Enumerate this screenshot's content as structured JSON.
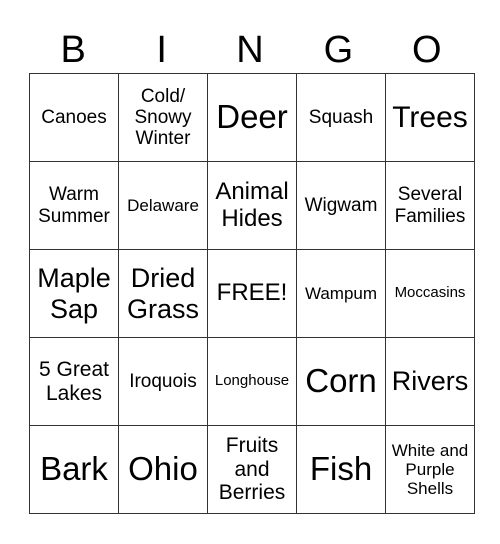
{
  "header": [
    "B",
    "I",
    "N",
    "G",
    "O"
  ],
  "rows": [
    [
      {
        "text": "Canoes",
        "size": "s19"
      },
      {
        "text": "Cold/ Snowy Winter",
        "size": "s19"
      },
      {
        "text": "Deer",
        "size": "s32"
      },
      {
        "text": "Squash",
        "size": "s19"
      },
      {
        "text": "Trees",
        "size": "s30"
      }
    ],
    [
      {
        "text": "Warm Summer",
        "size": "s19"
      },
      {
        "text": "Delaware",
        "size": "s16"
      },
      {
        "text": "Animal Hides",
        "size": "s24"
      },
      {
        "text": "Wigwam",
        "size": "s19"
      },
      {
        "text": "Several Families",
        "size": "s19"
      }
    ],
    [
      {
        "text": "Maple Sap",
        "size": "s27"
      },
      {
        "text": "Dried Grass",
        "size": "s27"
      },
      {
        "text": "FREE!",
        "size": "s24"
      },
      {
        "text": "Wampum",
        "size": "s16"
      },
      {
        "text": "Moccasins",
        "size": "s14"
      }
    ],
    [
      {
        "text": "5 Great Lakes",
        "size": "s21"
      },
      {
        "text": "Iroquois",
        "size": "s19"
      },
      {
        "text": "Longhouse",
        "size": "s14"
      },
      {
        "text": "Corn",
        "size": "s32"
      },
      {
        "text": "Rivers",
        "size": "s27"
      }
    ],
    [
      {
        "text": "Bark",
        "size": "s32"
      },
      {
        "text": "Ohio",
        "size": "s32"
      },
      {
        "text": "Fruits and Berries",
        "size": "s21"
      },
      {
        "text": "Fish",
        "size": "s32"
      },
      {
        "text": "White and Purple Shells",
        "size": "s16"
      }
    ]
  ]
}
